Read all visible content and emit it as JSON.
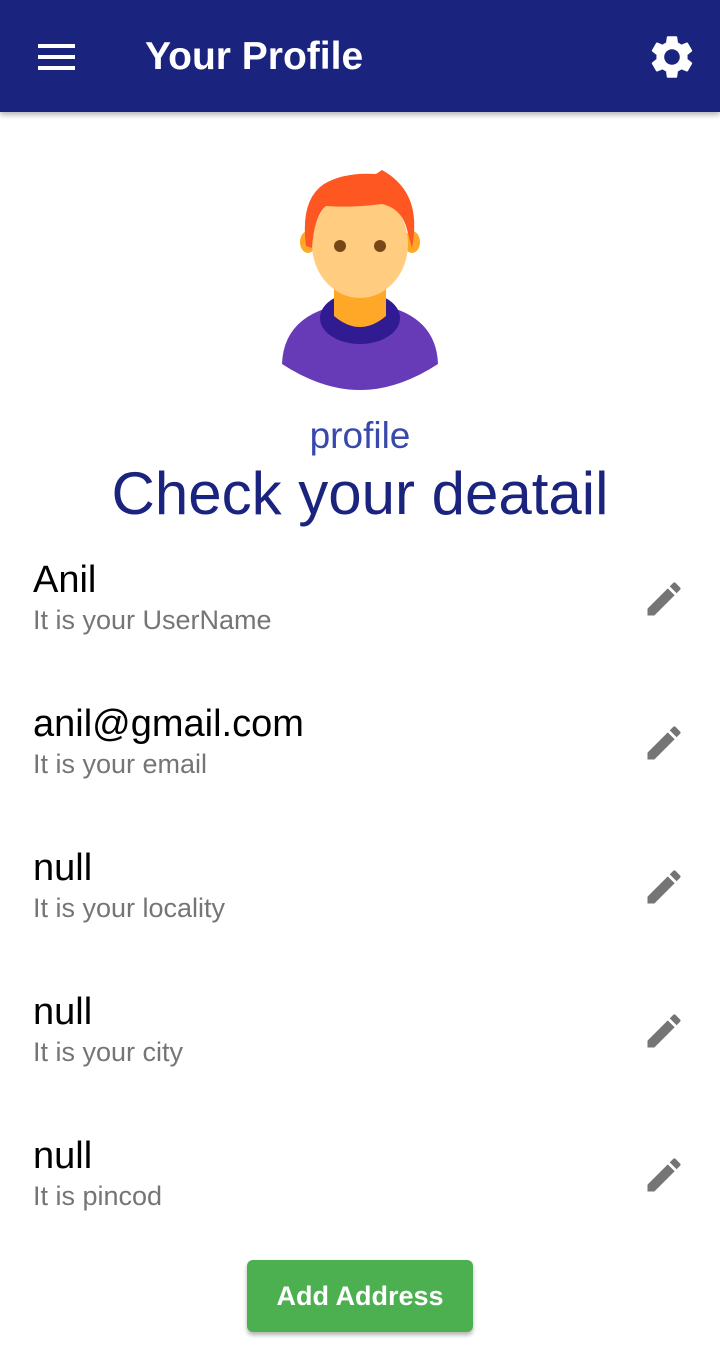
{
  "app_bar": {
    "title": "Your Profile",
    "menu_icon": "menu-icon",
    "settings_icon": "gear-icon",
    "background": "#1a237e"
  },
  "profile": {
    "avatar_icon": "avatar-person-icon",
    "avatar_label": "profile",
    "headline": "Check your deatail"
  },
  "details": [
    {
      "value": "Anil",
      "caption": "It is your UserName",
      "icon": "edit-pencil-icon"
    },
    {
      "value": "anil@gmail.com",
      "caption": "It is your email",
      "icon": "edit-pencil-icon"
    },
    {
      "value": "null",
      "caption": "It is your locality",
      "icon": "edit-pencil-icon"
    },
    {
      "value": "null",
      "caption": "It is your city",
      "icon": "edit-pencil-icon"
    },
    {
      "value": "null",
      "caption": "It is pincod",
      "icon": "edit-pencil-icon"
    }
  ],
  "actions": {
    "add_address_label": "Add Address",
    "button_color": "#4caf50"
  }
}
